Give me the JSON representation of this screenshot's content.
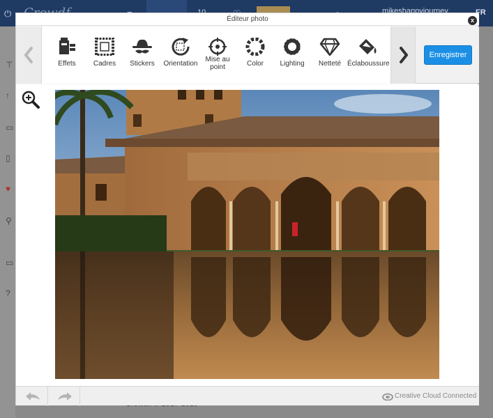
{
  "background": {
    "logo": "Crowdf",
    "username": "mikeshappyjourney",
    "lang": "FR",
    "count": "10",
    "footer": "Crowdfi © 2017-2019"
  },
  "modal": {
    "title": "Éditeur photo",
    "close_label": "x",
    "save_label": "Enregistrer"
  },
  "tools": [
    {
      "label": "Effets",
      "icon": "effects-icon"
    },
    {
      "label": "Cadres",
      "icon": "frames-icon"
    },
    {
      "label": "Stickers",
      "icon": "stickers-icon"
    },
    {
      "label": "Orientation",
      "icon": "orientation-icon"
    },
    {
      "label1": "Mise au",
      "label2": "point",
      "icon": "focus-icon"
    },
    {
      "label": "Color",
      "icon": "color-icon"
    },
    {
      "label": "Lighting",
      "icon": "lighting-icon"
    },
    {
      "label": "Netteté",
      "icon": "sharpness-icon"
    },
    {
      "label": "Éclaboussure",
      "icon": "splash-icon"
    }
  ],
  "footer": {
    "brand": "Creative Cloud Connected"
  },
  "colors": {
    "accent": "#1b8fe5",
    "topbar": "#1f3a63"
  }
}
